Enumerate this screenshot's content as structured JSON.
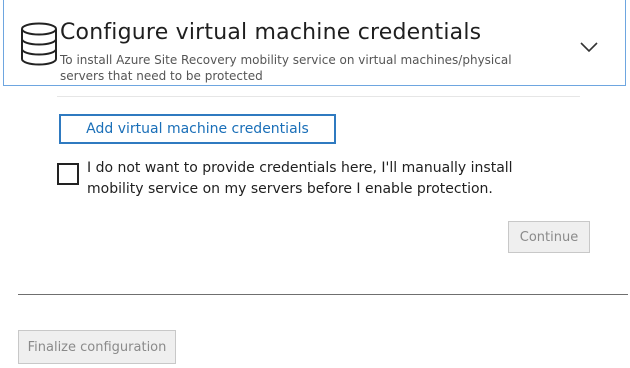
{
  "header": {
    "icon": "database-icon",
    "title": "Configure virtual machine credentials",
    "subtitle": "To install Azure Site Recovery mobility service on virtual machines/physical servers that need to be protected",
    "expand_icon": "chevron-down-icon"
  },
  "credentials": {
    "add_button_label": "Add virtual machine credentials",
    "manual_checkbox_checked": false,
    "manual_checkbox_label": "I do not want to provide credentials here, I'll manually install mobility service on my servers before I enable protection.",
    "continue_label": "Continue"
  },
  "footer": {
    "finalize_label": "Finalize configuration"
  },
  "colors": {
    "accent": "#2f7ac0",
    "header_border": "#6ea6e0",
    "disabled_bg": "#efefef",
    "disabled_text": "#8a8a8a"
  }
}
